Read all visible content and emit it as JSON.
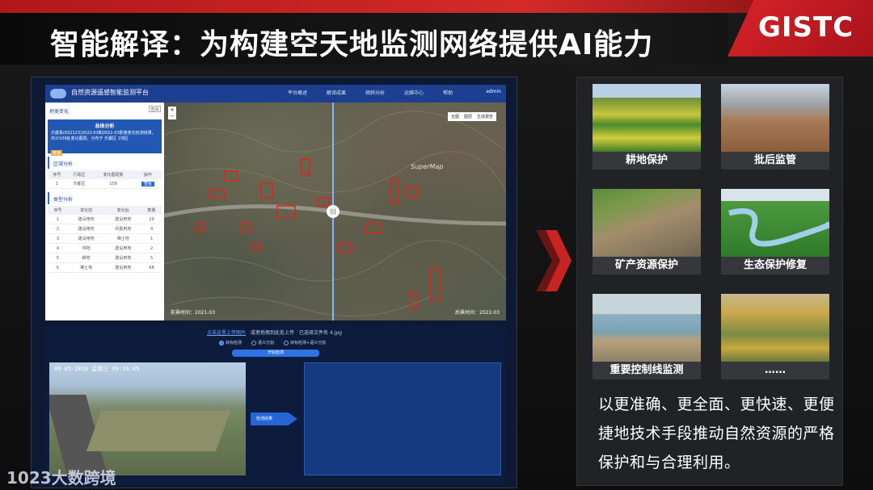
{
  "slide": {
    "title": "智能解译：为构建空天地监测网络提供AI能力",
    "logo": "GISTC",
    "watermark": "1023大数跨境"
  },
  "platform": {
    "title": "自然资源遥感智能监测平台",
    "nav": [
      "平台概述",
      "解译成果",
      "倾斜分析",
      "运维中心",
      "帮助"
    ],
    "user": "admin",
    "side": {
      "header": "地类变化",
      "search_btn": "查询",
      "summary_title": "总体分析",
      "summary_body": "乐都县(632123)2022-03和2021-03影像变化检测结果，共计109处变化图斑，分布于 乐都区 1地区",
      "summary_tag": "查看",
      "region_title": "区域分析",
      "region_headers": [
        "序号",
        "行政区",
        "变化图斑数",
        "操作"
      ],
      "region_rows": [
        [
          "1",
          "乐都区",
          "109",
          "查看"
        ]
      ],
      "type_title": "类型分析",
      "type_headers": [
        "序号",
        "变化前",
        "变化后",
        "数量"
      ],
      "type_rows": [
        [
          "1",
          "建设用地",
          "建设用地",
          "29"
        ],
        [
          "2",
          "建设用地",
          "闲置用地",
          "4"
        ],
        [
          "3",
          "建设用地",
          "裸土地",
          "1"
        ],
        [
          "4",
          "林地",
          "建设用地",
          "2"
        ],
        [
          "5",
          "耕地",
          "建设用地",
          "5"
        ],
        [
          "6",
          "裸土地",
          "建设用地",
          "68"
        ]
      ]
    },
    "map": {
      "toolbar": [
        "全图",
        "图层",
        "生成报告"
      ],
      "before": "前景时间：2021-03",
      "after": "后景时间：2022-03",
      "watermark": "SuperMap",
      "handle": "|||"
    },
    "detect": {
      "upload_link": "点击这里上传图片",
      "upload_hint": "或者拖拽到此处上传",
      "file": "已选择文件名 4.jpg",
      "options": [
        "目标检测",
        "语义分割",
        "目标检测+语义分割"
      ],
      "start": "开始检测",
      "timestamp": "09-05-2018  星期三  09:16:45",
      "result_btn": "检测结果"
    }
  },
  "tiles": [
    {
      "label": "耕地保护"
    },
    {
      "label": "批后监管"
    },
    {
      "label": "矿产资源保护"
    },
    {
      "label": "生态保护修复"
    },
    {
      "label": "重要控制线监测"
    },
    {
      "label": "……"
    }
  ],
  "description": "以更准确、更全面、更快速、更便捷地技术手段推动自然资源的严格保护和与合理利用。"
}
